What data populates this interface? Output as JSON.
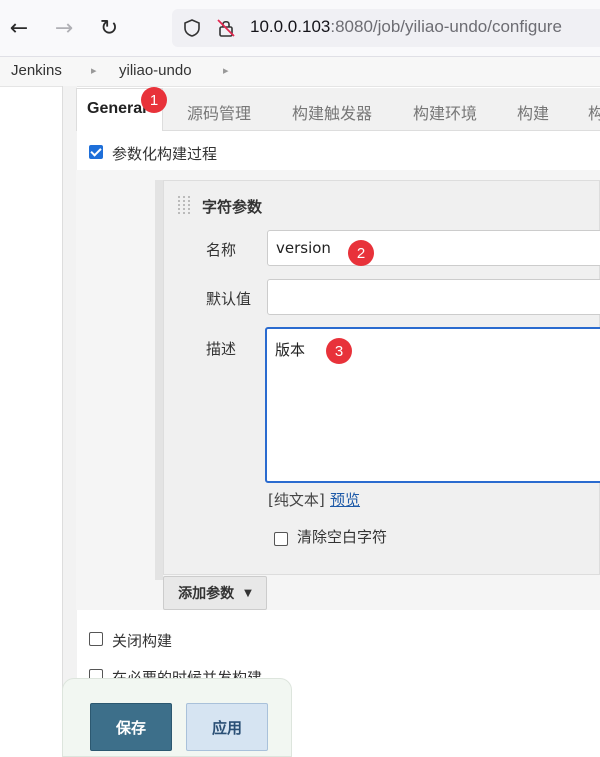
{
  "browser": {
    "url_host": "10.0.0.103",
    "url_rest": ":8080/job/yiliao-undo/configure"
  },
  "breadcrumb": [
    "Jenkins",
    "yiliao-undo"
  ],
  "tabs": [
    "General",
    "源码管理",
    "构建触发器",
    "构建环境",
    "构建",
    "构"
  ],
  "badges": [
    "1",
    "2",
    "3"
  ],
  "parameterized": {
    "label": "参数化构建过程",
    "checked": true
  },
  "param": {
    "title": "字符参数",
    "name_label": "名称",
    "name_value": "version",
    "default_label": "默认值",
    "default_value": "",
    "desc_label": "描述",
    "desc_value": "版本",
    "plain_text": "[纯文本]",
    "preview": "预览",
    "trim_label": "清除空白字符"
  },
  "add_param_button": "添加参数",
  "options": [
    {
      "label": "关闭构建",
      "checked": false
    },
    {
      "label": "在必要的时候并发构建",
      "checked": false
    }
  ],
  "buttons": {
    "save": "保存",
    "apply": "应用"
  },
  "colors": {
    "badge": "#e8323a",
    "save": "#3d6f8a",
    "apply": "#d6e4f2",
    "link": "#1e5aa8"
  }
}
